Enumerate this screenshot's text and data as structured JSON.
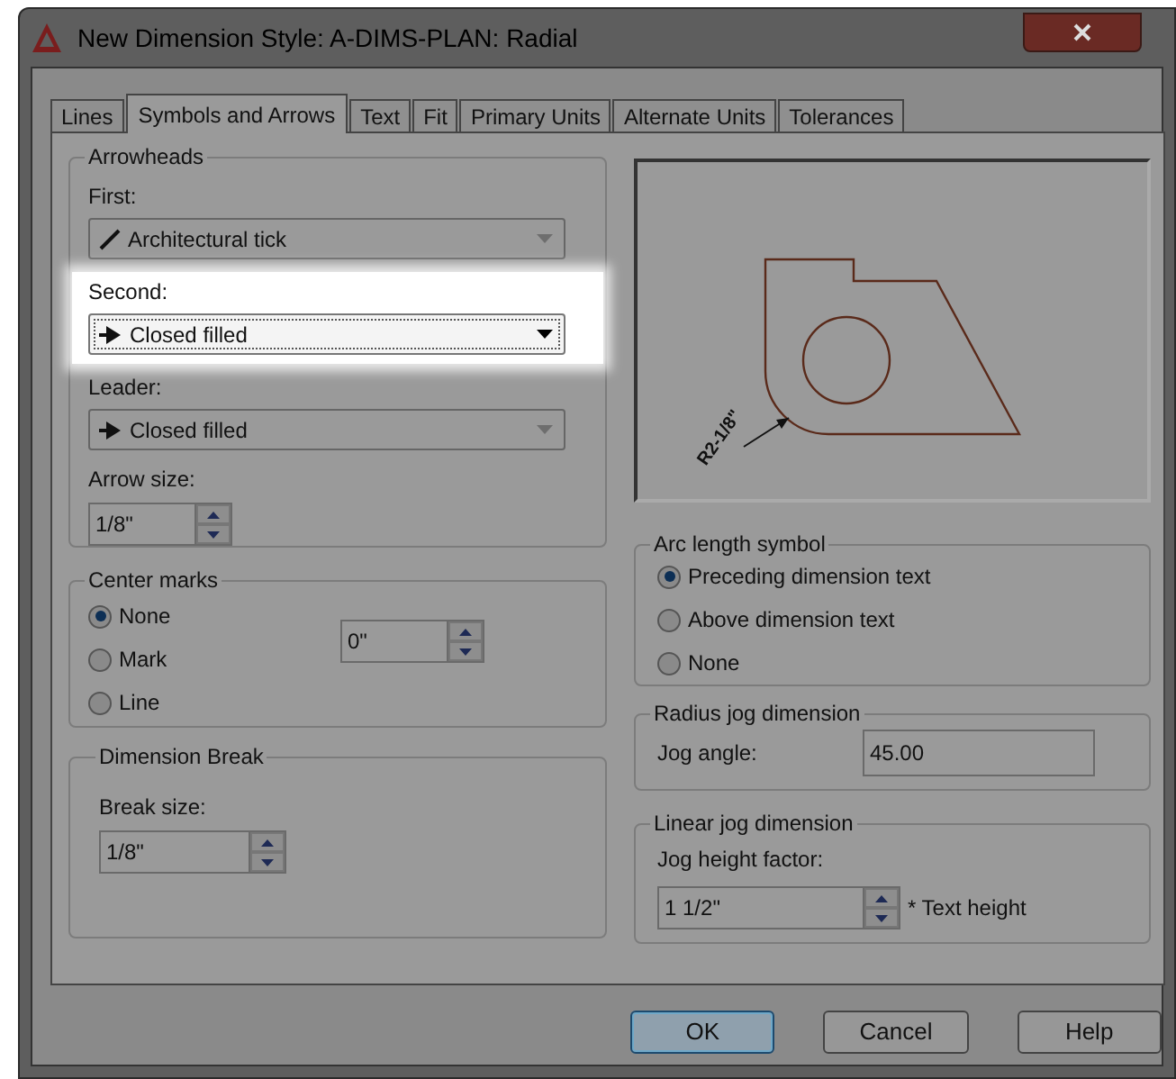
{
  "window": {
    "title": "New Dimension Style: A-DIMS-PLAN: Radial"
  },
  "tabs": [
    {
      "label": "Lines",
      "selected": false
    },
    {
      "label": "Symbols and Arrows",
      "selected": true
    },
    {
      "label": "Text",
      "selected": false
    },
    {
      "label": "Fit",
      "selected": false
    },
    {
      "label": "Primary Units",
      "selected": false
    },
    {
      "label": "Alternate Units",
      "selected": false
    },
    {
      "label": "Tolerances",
      "selected": false
    }
  ],
  "arrowheads": {
    "title": "Arrowheads",
    "fields": [
      {
        "label": "First:",
        "value": "Architectural tick",
        "kind": "tick",
        "highlighted": false
      },
      {
        "label": "Second:",
        "value": "Closed filled",
        "kind": "arrow",
        "highlighted": true
      },
      {
        "label": "Leader:",
        "value": "Closed filled",
        "kind": "arrow",
        "highlighted": false
      }
    ],
    "arrow_size": {
      "label": "Arrow size:",
      "value": "1/8\""
    }
  },
  "center_marks": {
    "title": "Center marks",
    "options": [
      {
        "label": "None",
        "selected": true
      },
      {
        "label": "Mark",
        "selected": false
      },
      {
        "label": "Line",
        "selected": false
      }
    ],
    "size": "0\""
  },
  "dimension_break": {
    "title": "Dimension Break",
    "label": "Break size:",
    "value": "1/8\""
  },
  "preview": {
    "dimension_text": "R2-1/8\""
  },
  "arc_length_symbol": {
    "title": "Arc length symbol",
    "options": [
      {
        "label": "Preceding dimension text",
        "selected": true
      },
      {
        "label": "Above dimension text",
        "selected": false
      },
      {
        "label": "None",
        "selected": false
      }
    ]
  },
  "radius_jog": {
    "title": "Radius jog dimension",
    "label": "Jog angle:",
    "value": "45.00"
  },
  "linear_jog": {
    "title": "Linear jog dimension",
    "label": "Jog height factor:",
    "value": "1 1/2\"",
    "suffix": "* Text height"
  },
  "buttons": [
    {
      "label": "OK",
      "default": true
    },
    {
      "label": "Cancel",
      "default": false
    },
    {
      "label": "Help",
      "default": false
    }
  ]
}
